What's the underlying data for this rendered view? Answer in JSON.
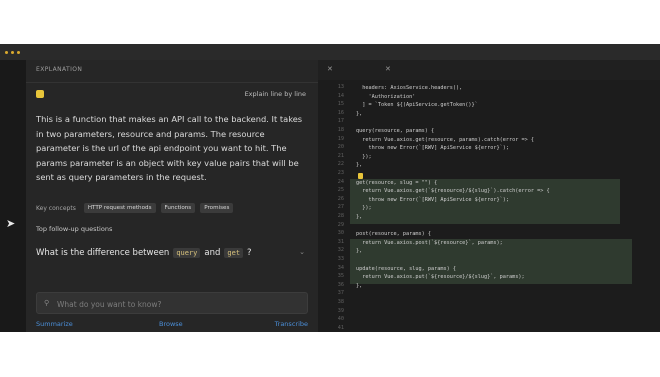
{
  "panel": {
    "title": "EXPLANATION",
    "explain_label": "Explain line by line",
    "description": "This is a function that makes an API call to the backend. It takes in two parameters, resource and params. The resource parameter is the url of the api endpoint you want to hit. The params parameter is an object with key value pairs that will be sent as query parameters in the request.",
    "concepts_label": "Key concepts",
    "concepts": [
      "HTTP request methods",
      "Functions",
      "Promises"
    ],
    "followup_label": "Top follow-up questions",
    "question": {
      "prefix": "What is the difference between",
      "code1": "query",
      "mid": "and",
      "code2": "get",
      "suffix": "?"
    },
    "ask_placeholder": "What do you want to know?",
    "nav": {
      "left": "Summarize",
      "center": "Browse",
      "right": "Transcribe"
    }
  },
  "editor": {
    "line_numbers": [
      "13",
      "14",
      "15",
      "16",
      "17",
      "18",
      "19",
      "20",
      "21",
      "22",
      "23",
      "24",
      "25",
      "26",
      "27",
      "28",
      "29",
      "30",
      "31",
      "32",
      "33",
      "34",
      "35",
      "36",
      "37",
      "38",
      "39",
      "40",
      "41"
    ],
    "lines": [
      "  headers: AxiosService.headers(),",
      "    'Authorization'",
      "  ] = `Token ${(ApiService.getToken()}`",
      "},",
      "",
      "query(resource, params) {",
      "  return Vue.axios.get(resource, params).catch(error => {",
      "    throw new Error(`[RWV] ApiService ${error}`);",
      "  });",
      "},",
      "",
      "get(resource, slug = \"\") {",
      "  return Vue.axios.get(`${resource}/${slug}`).catch(error => {",
      "    throw new Error(`[RWV] ApiService ${error}`);",
      "  });",
      "},",
      "",
      "post(resource, params) {",
      "  return Vue.axios.post(`${resource}`, params);",
      "},",
      "",
      "update(resource, slug, params) {",
      "  return Vue.axios.put(`${resource}/${slug}`, params);",
      "},",
      "",
      "",
      "",
      "",
      ""
    ]
  },
  "colors": {
    "accent": "#4b8fd9",
    "bulb": "#e8c53a",
    "highlight": "#2f3a2f"
  }
}
